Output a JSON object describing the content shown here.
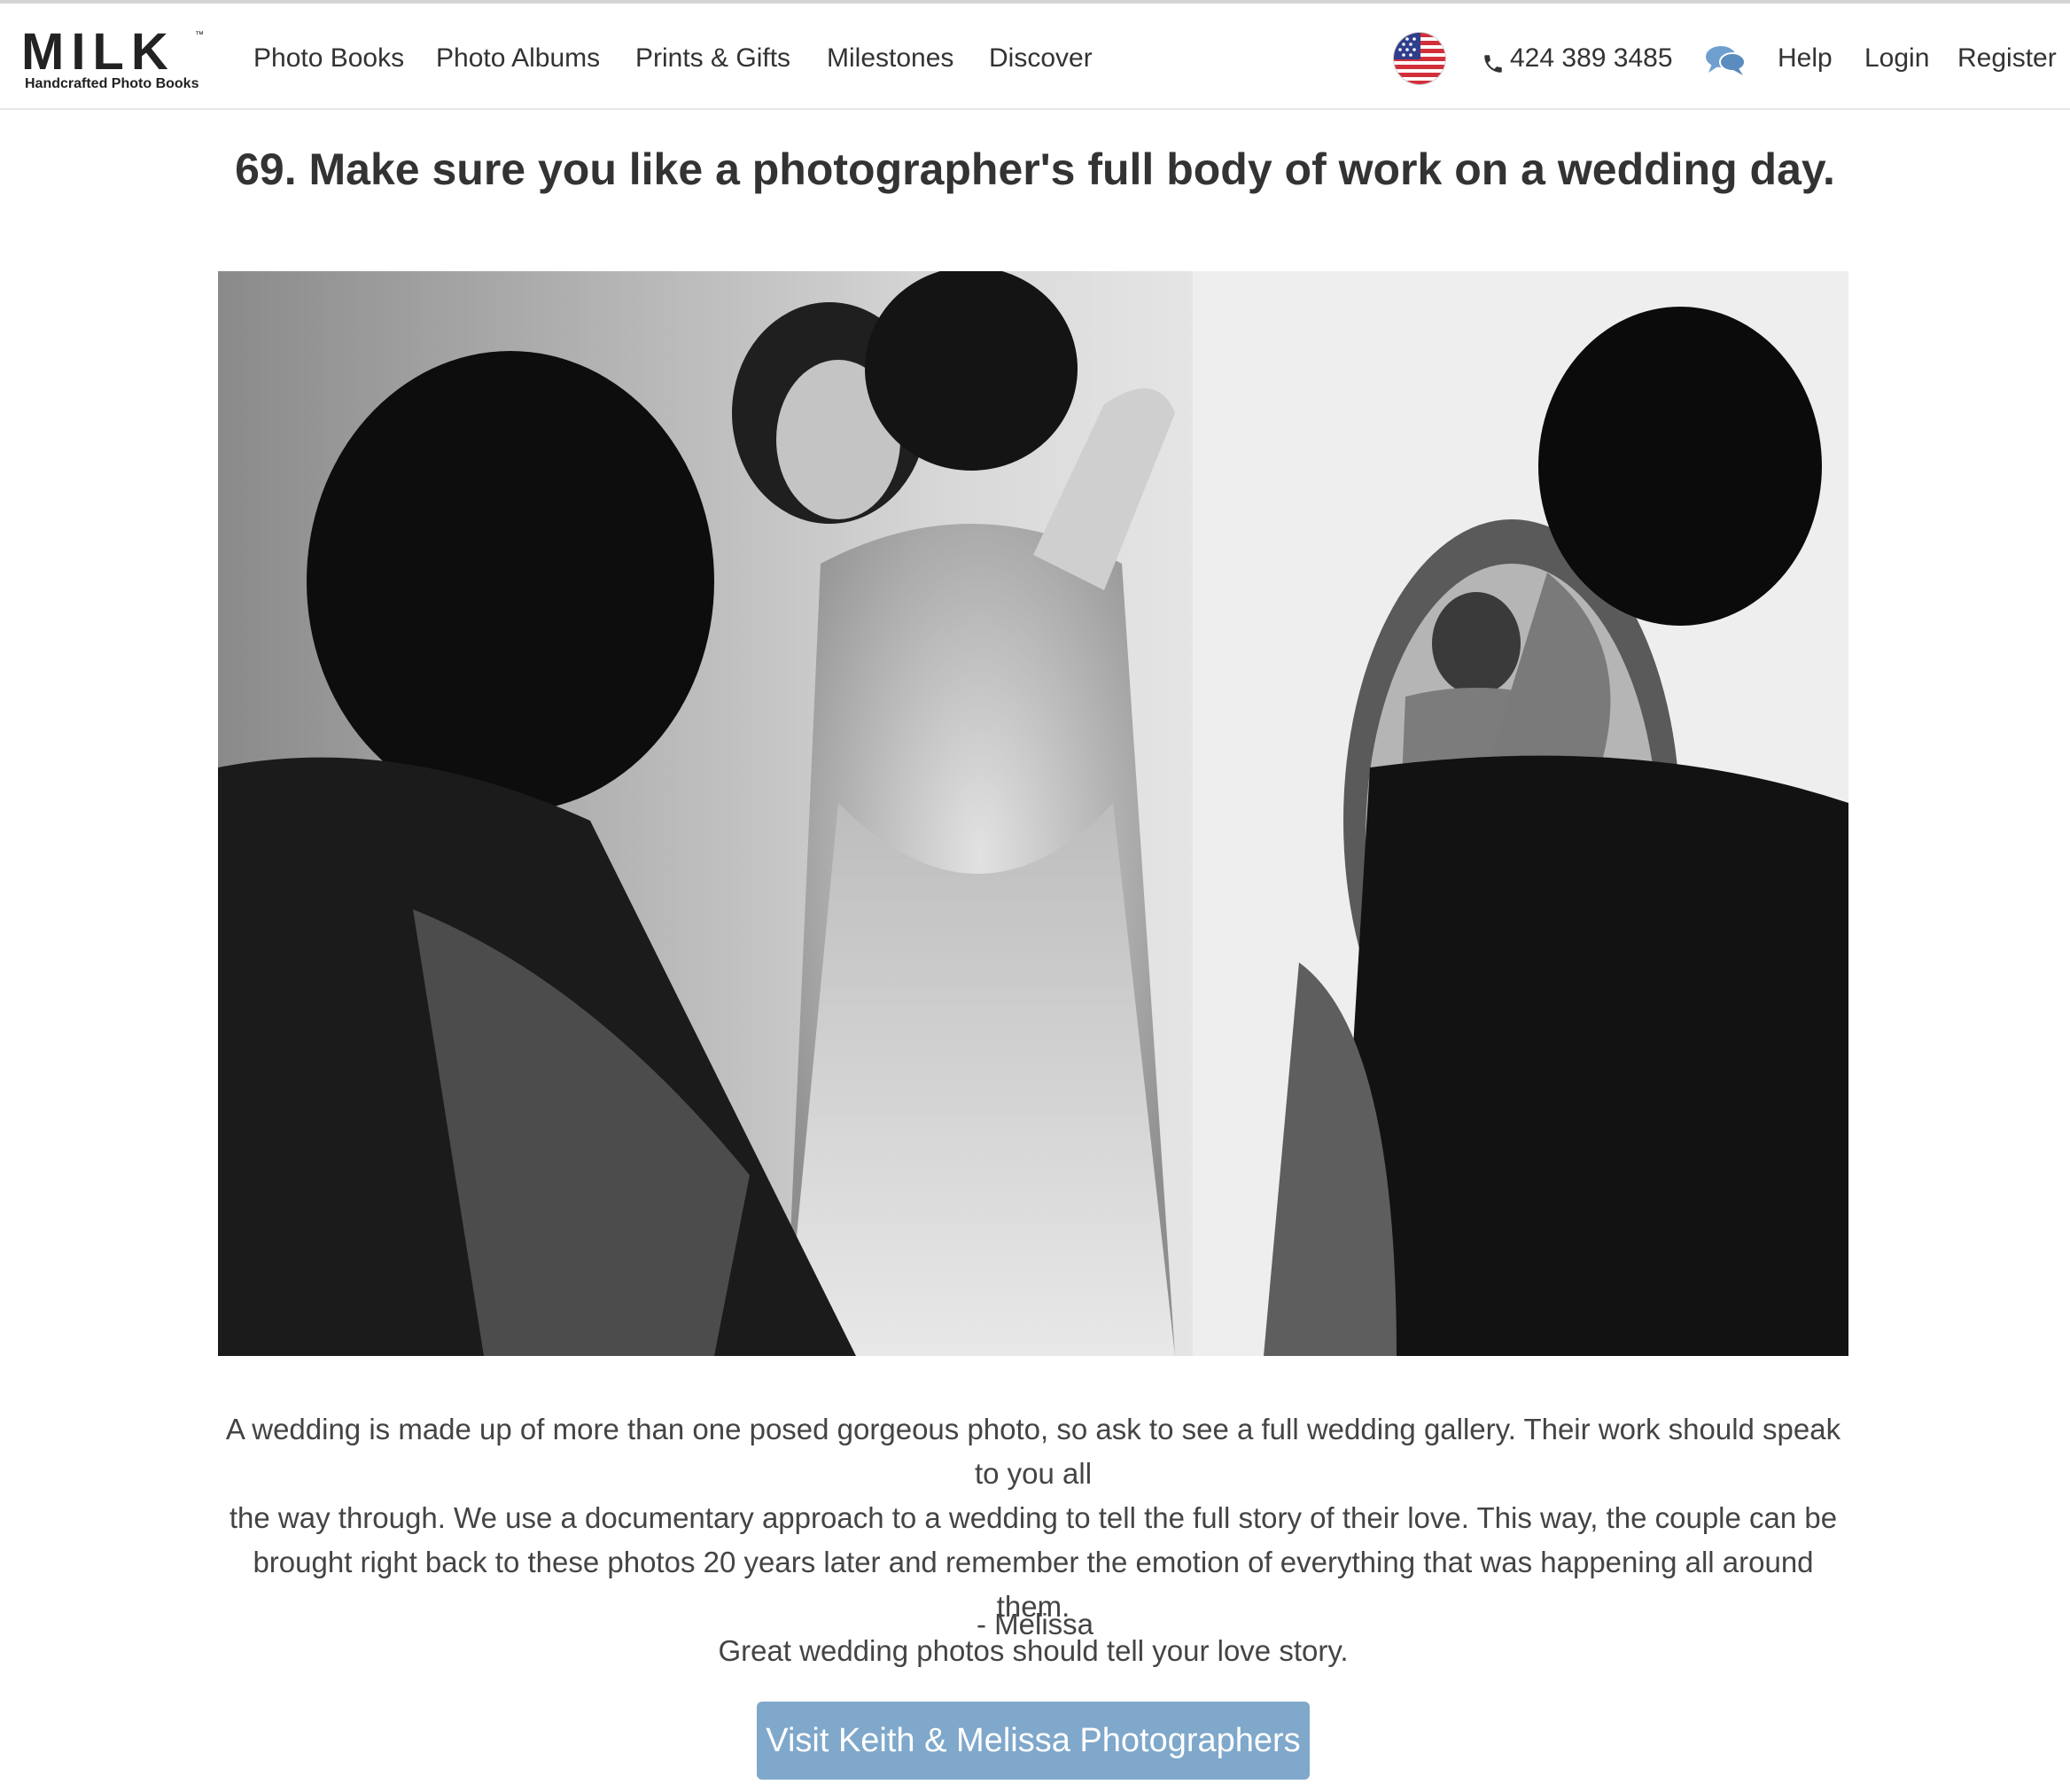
{
  "header": {
    "logo_text": "MILK",
    "logo_trademark": "™",
    "logo_tagline": "Handcrafted Photo Books",
    "nav": [
      "Photo Books",
      "Photo Albums",
      "Prints & Gifts",
      "Milestones",
      "Discover"
    ],
    "country_flag_icon": "us-flag-icon",
    "phone_icon": "phone-icon",
    "phone": "424 389 3485",
    "chat_icon": "chat-bubbles-icon",
    "help": "Help",
    "login": "Login",
    "register": "Register"
  },
  "article": {
    "title": "69. Make sure you like a photographer's full body of work on a wedding day.",
    "body_lines": [
      "A wedding is made up of more than one posed gorgeous photo, so ask to see a full wedding gallery. Their work should speak to you all",
      "the way through. We use a documentary approach to a wedding to tell the full story of their love. This way, the couple can be",
      "brought right back to these photos 20 years later and remember the emotion of everything that was happening all around them.",
      "Great wedding photos should tell your love story."
    ],
    "signature": "- Melissa",
    "cta": "Visit Keith & Melissa Photographers"
  },
  "colors": {
    "cta_background": "#7fa8cb",
    "chat_icon": "#6f9fcf",
    "text": "#333333"
  }
}
